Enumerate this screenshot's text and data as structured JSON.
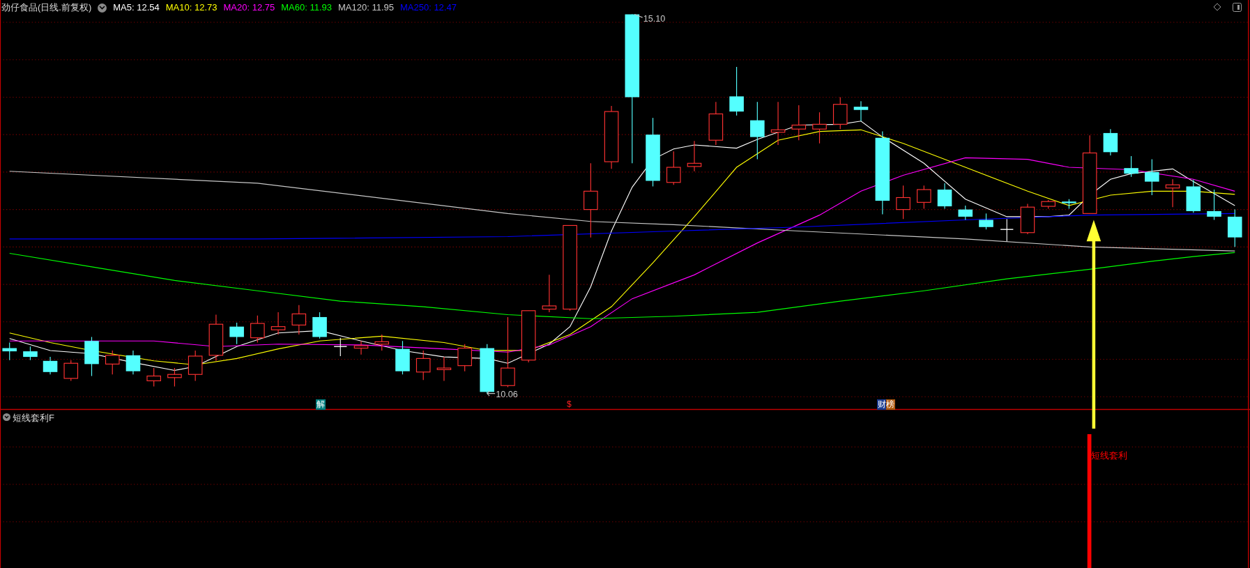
{
  "header": {
    "title": "劲仔食品(日线.前复权)",
    "ma_labels": [
      {
        "text": "MA5: 12.54",
        "color": "#ffffff"
      },
      {
        "text": "MA10: 12.73",
        "color": "#ffff00"
      },
      {
        "text": "MA20: 12.75",
        "color": "#ff00ff"
      },
      {
        "text": "MA60: 11.93",
        "color": "#00ff00"
      },
      {
        "text": "MA120: 11.95",
        "color": "#c8c8c8"
      },
      {
        "text": "MA250: 12.47",
        "color": "#0000ff"
      }
    ]
  },
  "main_chart": {
    "high_label": "15.10",
    "low_label": "10.06",
    "event_marks": [
      {
        "kind": "unlock",
        "text": "解"
      },
      {
        "kind": "dividend",
        "text": "$"
      },
      {
        "kind": "earnings",
        "text": "财榜"
      }
    ]
  },
  "indicator_pane": {
    "title": "短线套利F",
    "signal_label": "短线套利"
  }
}
